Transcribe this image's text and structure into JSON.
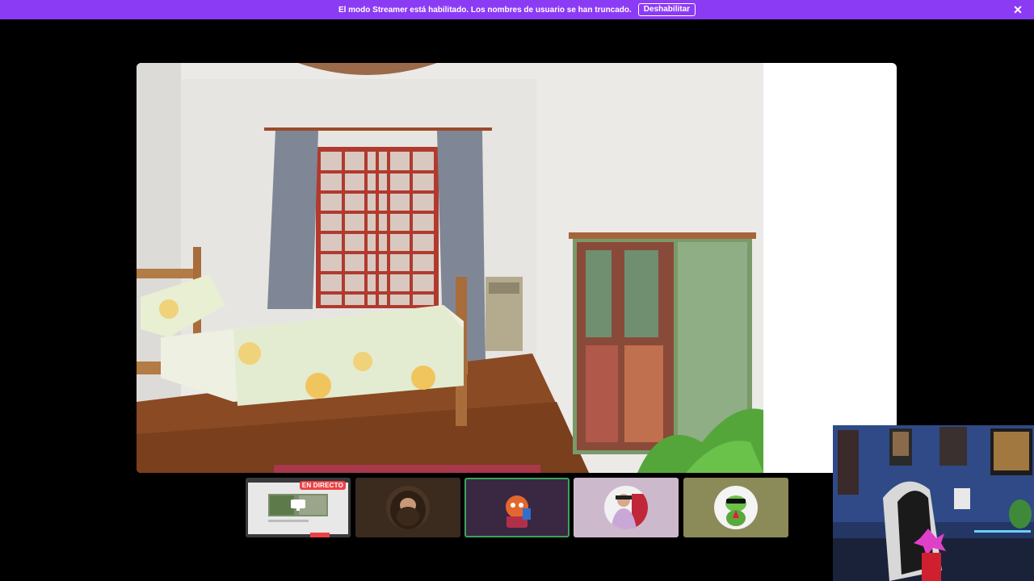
{
  "banner": {
    "text": "El modo Streamer está habilitado. Los nombres de usuario se han truncado.",
    "button_label": "Deshabilitar",
    "close_icon": "close-icon",
    "color": "#8c3bf5"
  },
  "stage": {
    "content": "shared-screen-bedroom-photo"
  },
  "tiles": {
    "live_badge": "EN DIRECTO",
    "live_color": "#ed4245",
    "active_border_color": "#3aa55c",
    "items": [
      {
        "name": "screen-share",
        "bg": "#3a3a3a"
      },
      {
        "name": "hagrid-avatar",
        "bg": "#3b2a1e"
      },
      {
        "name": "cartoon-avatar",
        "bg": "#3a2742"
      },
      {
        "name": "person-avatar",
        "bg": "#cdb9cc"
      },
      {
        "name": "frog-avatar",
        "bg": "#8b8a59"
      }
    ]
  },
  "webcam": {
    "content": "streamer-webcam-room"
  }
}
